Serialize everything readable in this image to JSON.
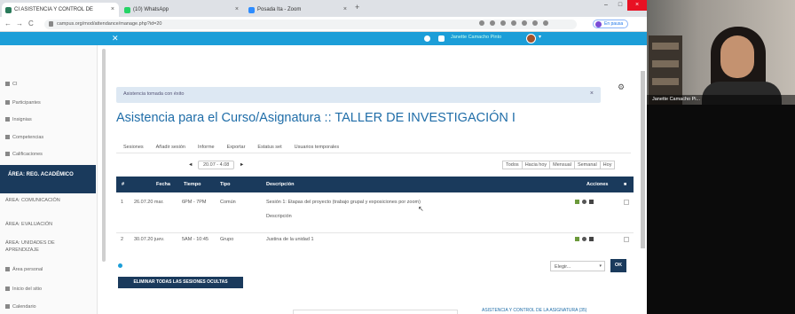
{
  "browser": {
    "tabs": [
      {
        "label": "CI ASISTENCIA Y CONTROL DE"
      },
      {
        "label": "(10) WhatsApp"
      },
      {
        "label": "Posada Ita - Zoom"
      }
    ],
    "url": "campus.org/mod/attendance/manage.php?id=20",
    "profile_label": "En pausa"
  },
  "site": {
    "username": "Janette Camacho Pinto"
  },
  "sidebar": {
    "items": [
      {
        "label": "CI"
      },
      {
        "label": "Participantes"
      },
      {
        "label": "Insignias"
      },
      {
        "label": "Competencias"
      },
      {
        "label": "Calificaciones"
      },
      {
        "label": "ÁREA: REG. ACADÉMICO"
      },
      {
        "label": "ÁREA: COMUNICACIÓN"
      },
      {
        "label": "ÁREA: EVALUACIÓN"
      },
      {
        "label": "ÁREA: UNIDADES DE APRENDIZAJE"
      },
      {
        "label": "Área personal"
      },
      {
        "label": "Inicio del sitio"
      },
      {
        "label": "Calendario"
      }
    ]
  },
  "notice": {
    "text": "Asistencia tomada con éxito",
    "close": "×"
  },
  "page_title": "Asistencia para el Curso/Asignatura :: TALLER DE INVESTIGACIÓN I",
  "tabs": [
    "Sesiones",
    "Añadir sesión",
    "Informe",
    "Exportar",
    "Estatus set",
    "Usuarios temporales"
  ],
  "date_nav": {
    "prev": "◄",
    "current": "20.07 - 4.08",
    "next": "►"
  },
  "views": [
    "Todos",
    "Hacia hoy",
    "Mensual",
    "Semanal",
    "Hoy"
  ],
  "table": {
    "headers": [
      "#",
      "Fecha",
      "Tiempo",
      "Tipo",
      "Descripción",
      "Acciones"
    ],
    "rows": [
      {
        "num": "1",
        "date": "26.07.20 mar.",
        "time": "6PM - 7PM",
        "type": "Común",
        "desc": "Sesión 1: Etapas del proyecto (trabajo grupal y exposiciones por zoom)",
        "desc2": "Descripción"
      },
      {
        "num": "2",
        "date": "30.07.20 juev.",
        "time": "5AM - 10:45",
        "type": "Grupo",
        "desc": "Justina de la unidad 1"
      }
    ]
  },
  "bulk": {
    "select": "Elegir...",
    "ok": "OK",
    "delete_all": "ELIMINAR TODAS LAS SESIONES OCULTAS"
  },
  "footer_link": "ASISTENCIA Y CONTROL DE LA ASIGNATURA (35)",
  "webcam": {
    "name": "Janette Camacho Pi..."
  },
  "colors": {
    "primary": "#1c9ed8",
    "dark": "#1a3a5c",
    "title": "#1f6da8"
  }
}
